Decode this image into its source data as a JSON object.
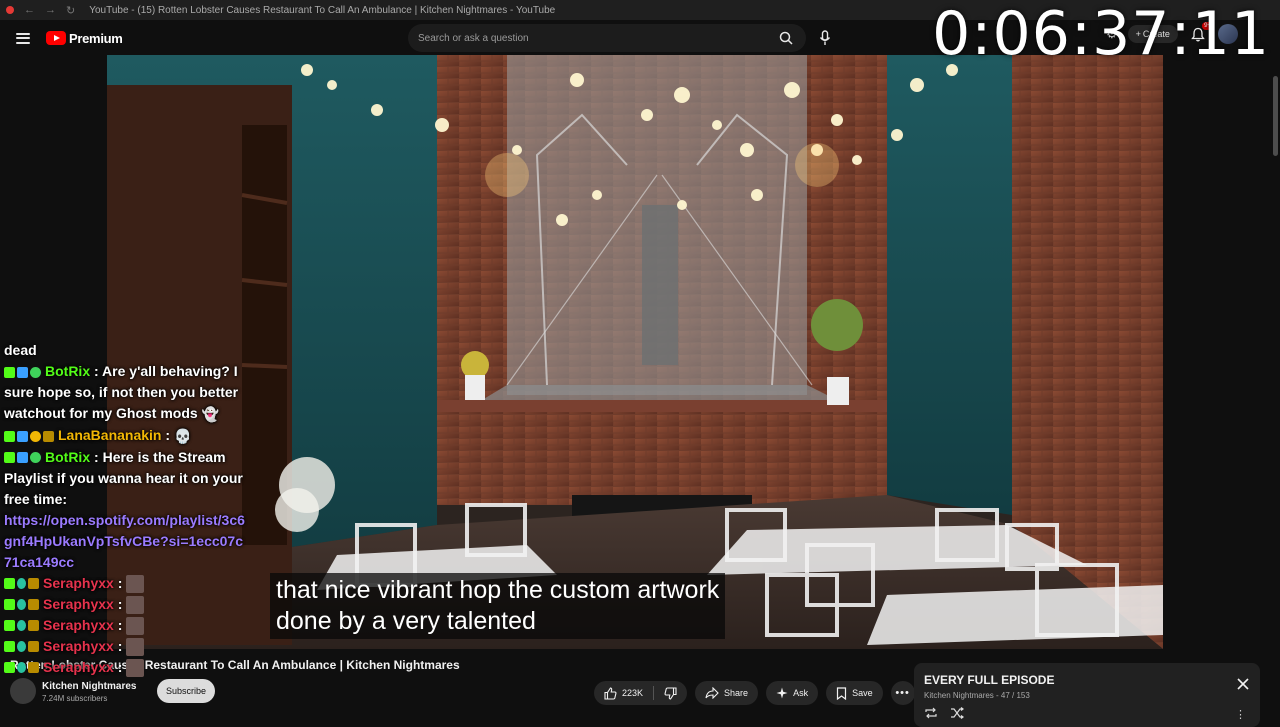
{
  "browser": {
    "window_title": "YouTube - (15) Rotten Lobster Causes Restaurant To Call An Ambulance | Kitchen Nightmares - YouTube"
  },
  "header": {
    "logo_text": "Premium",
    "search_placeholder": "Search or ask a question",
    "create_label": "Create",
    "notification_badge": "9+"
  },
  "overlay": {
    "timer": "0:06:37:11"
  },
  "video": {
    "subtitle_lines": [
      "that nice vibrant hop the custom artwork",
      "done by a very talented"
    ]
  },
  "chat": {
    "messages": [
      {
        "user": "",
        "user_color": "#ffffff",
        "badges": [],
        "text": "dead"
      },
      {
        "user": "BotRix",
        "user_color": "#53fc18",
        "badges": [
          "k",
          "b",
          "g"
        ],
        "text": "Are y'all behaving? I sure hope so, if not then you better watchout for my Ghost mods",
        "suffix_ghost": "👻"
      },
      {
        "user": "LanaBananakin",
        "user_color": "#f2b705",
        "badges": [
          "k",
          "b",
          "o",
          "c"
        ],
        "text": "",
        "suffix_ghost": "💀"
      },
      {
        "user": "BotRix",
        "user_color": "#53fc18",
        "badges": [
          "k",
          "b",
          "g"
        ],
        "text": "Here is the Stream Playlist if you wanna hear it on your free time:",
        "link": "https://open.spotify.com/playlist/3c6gnf4HpUkanVpTsfvCBe?si=1ecc07c71ca149cc"
      },
      {
        "user": "Seraphyxx",
        "user_color": "#e6334d",
        "badges": [
          "k",
          "s",
          "c"
        ],
        "text": "",
        "emote": true
      },
      {
        "user": "Seraphyxx",
        "user_color": "#e6334d",
        "badges": [
          "k",
          "s",
          "c"
        ],
        "text": "",
        "emote": true
      },
      {
        "user": "Seraphyxx",
        "user_color": "#e6334d",
        "badges": [
          "k",
          "s",
          "c"
        ],
        "text": "",
        "emote": true
      },
      {
        "user": "Seraphyxx",
        "user_color": "#e6334d",
        "badges": [
          "k",
          "s",
          "c"
        ],
        "text": "",
        "emote": true
      },
      {
        "user": "Seraphyxx",
        "user_color": "#e6334d",
        "badges": [
          "k",
          "s",
          "c"
        ],
        "text": "",
        "emote": true
      }
    ]
  },
  "below_video": {
    "title": "Rotten Lobster Causes Restaurant To Call An Ambulance | Kitchen Nightmares",
    "channel_name": "Kitchen Nightmares",
    "subscribers": "7.24M subscribers",
    "subscribe_label": "Subscribe",
    "like_count": "223K",
    "share_label": "Share",
    "ask_label": "Ask",
    "save_label": "Save"
  },
  "playlist": {
    "title": "EVERY FULL EPISODE",
    "subtitle": "Kitchen Nightmares - 47 / 153"
  },
  "colors": {
    "youtube_red": "#ff0000",
    "kick_green": "#53fc18",
    "link_purple": "#9b7bff"
  }
}
